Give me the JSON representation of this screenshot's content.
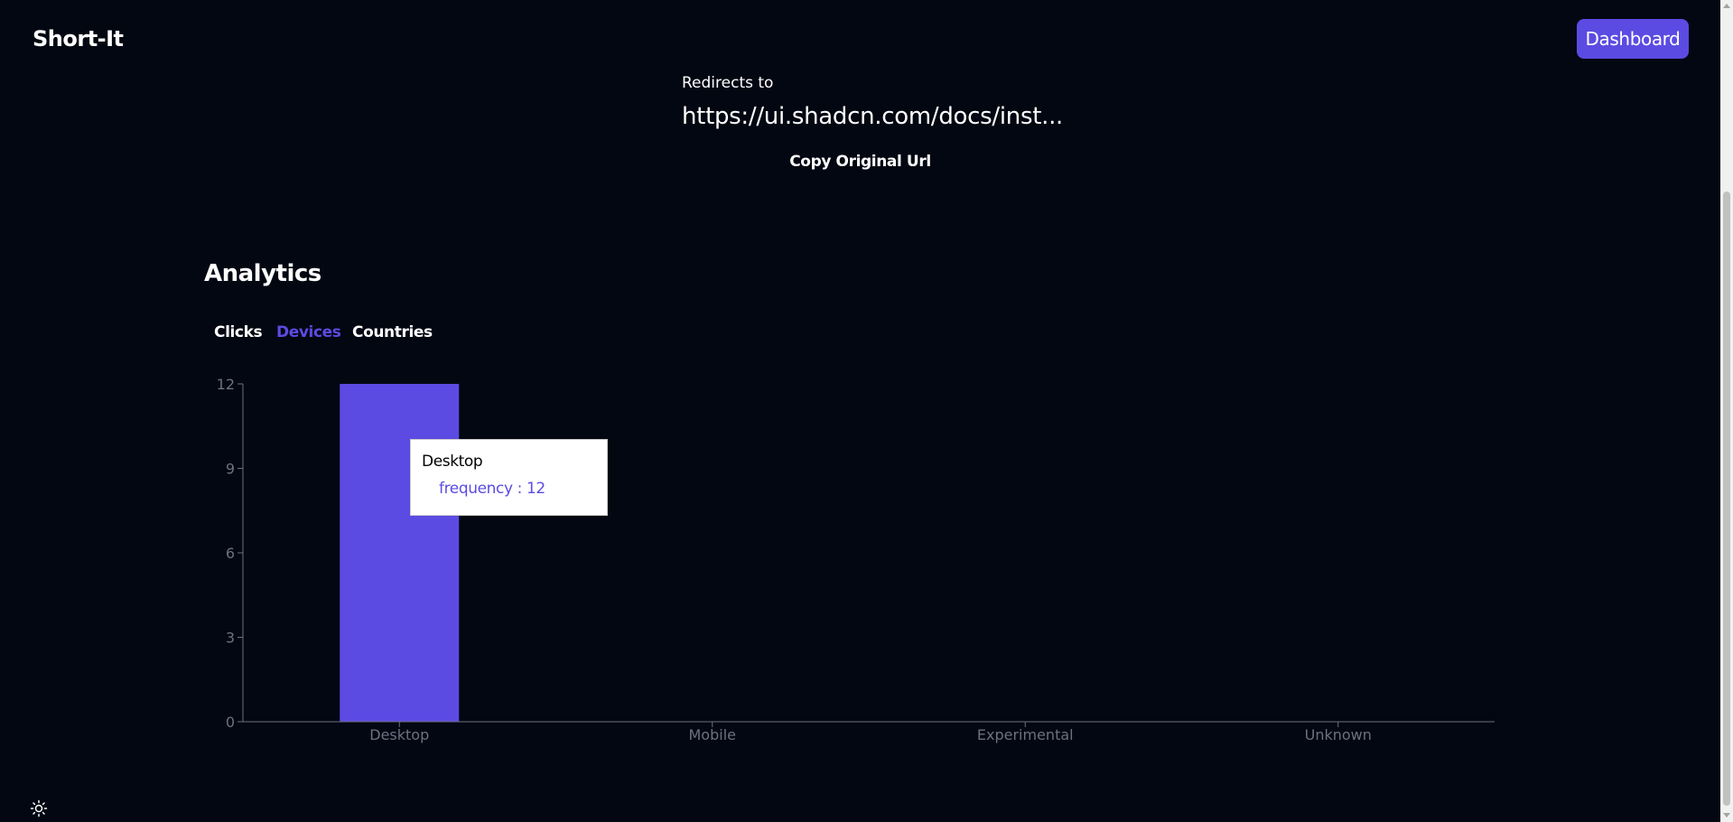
{
  "header": {
    "logo": "Short-It",
    "dashboard_label": "Dashboard"
  },
  "link": {
    "redirect_label": "Redirects to",
    "redirect_url": "https://ui.shadcn.com/docs/inst...",
    "copy_label": "Copy Original Url"
  },
  "analytics": {
    "title": "Analytics",
    "tabs": [
      "Clicks",
      "Devices",
      "Countries"
    ],
    "active_tab": "Devices"
  },
  "tooltip": {
    "label": "Desktop",
    "value_text": "frequency : 12"
  },
  "colors": {
    "accent": "#5b4be2",
    "background": "#030712",
    "axis": "#6b7280"
  },
  "icons": {
    "theme_toggle": "sun-icon"
  },
  "chart_data": {
    "type": "bar",
    "categories": [
      "Desktop",
      "Mobile",
      "Experimental",
      "Unknown"
    ],
    "series": [
      {
        "values": [
          12,
          0,
          0,
          0
        ]
      }
    ],
    "ylim": [
      0,
      12
    ],
    "yticks": [
      0,
      3,
      6,
      9,
      12
    ],
    "grid": false,
    "xlabel": "",
    "ylabel": ""
  }
}
